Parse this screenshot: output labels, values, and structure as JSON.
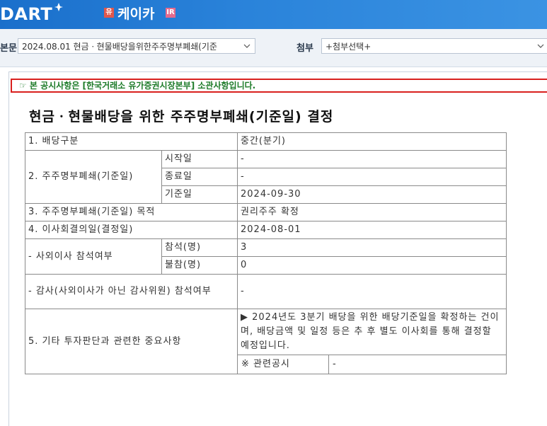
{
  "header": {
    "logo_text": "DART",
    "badge_left": "유",
    "company_name": "케이카",
    "badge_right": "IR"
  },
  "toolbar": {
    "report_label": "본문",
    "report_value": "2024.08.01  현금ㆍ현물배당을위한주주명부폐쇄(기준",
    "attach_label": "첨부",
    "attach_value": "+첨부선택+"
  },
  "notice": "☞ 본 공시사항은 [한국거래소 유가증권시장본부] 소관사항입니다.",
  "title": "현금ㆍ현물배당을 위한 주주명부폐쇄(기준일) 결정",
  "table": {
    "r1_label": "1. 배당구분",
    "r1_value": "중간(분기)",
    "r2_label": "2. 주주명부폐쇄(기준일)",
    "r2_sub_start": "시작일",
    "r2_val_start": "-",
    "r2_sub_end": "종료일",
    "r2_val_end": "-",
    "r2_sub_record": "기준일",
    "r2_val_record": "2024-09-30",
    "r3_label": "3. 주주명부폐쇄(기준일) 목적",
    "r3_value": "권리주주 확정",
    "r4_label": "4. 이사회결의일(결정일)",
    "r4_value": "2024-08-01",
    "r5_label": "- 사외이사 참석여부",
    "r5_sub_present": "참석(명)",
    "r5_val_present": "3",
    "r5_sub_absent": "불참(명)",
    "r5_val_absent": "0",
    "r6_label": "- 감사(사외이사가 아닌 감사위원) 참석여부",
    "r6_value": "-",
    "r7_label": "5. 기타 투자판단과 관련한 중요사항",
    "r7_value": "▶ 2024년도 3분기 배당을 위한 배당기준일을 확정하는 건이며, 배당금액 및 일정 등은 추 후 별도 이사회를 통해 결정할 예정입니다.",
    "r7_related_label": "※ 관련공시",
    "r7_related_value": "-"
  }
}
